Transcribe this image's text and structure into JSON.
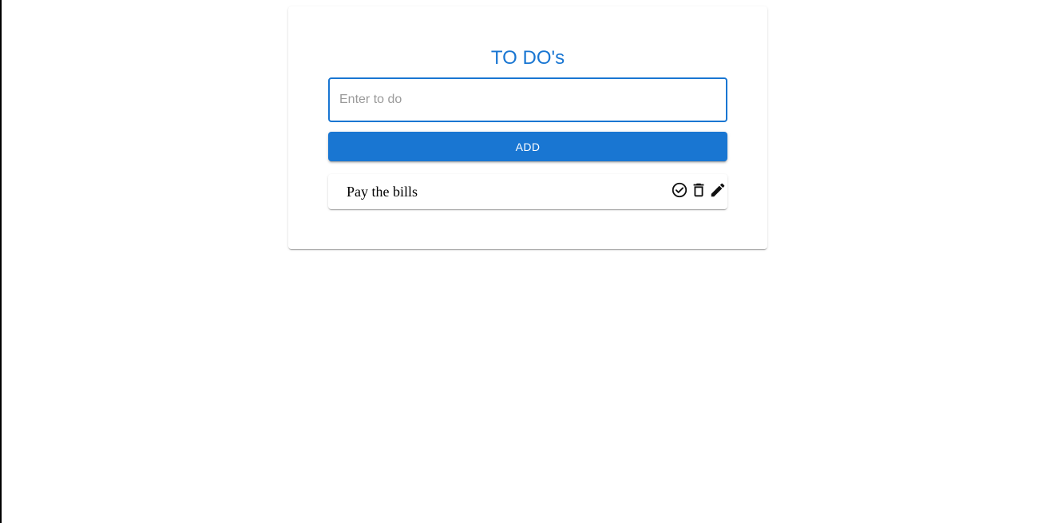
{
  "app": {
    "title": "TO DO's"
  },
  "input": {
    "placeholder": "Enter to do",
    "value": ""
  },
  "add_button": {
    "label": "ADD"
  },
  "todos": [
    {
      "text": "Pay the bills",
      "actions": [
        "check-circle-icon",
        "delete-icon",
        "edit-pencil-icon"
      ]
    }
  ],
  "colors": {
    "accent": "#1976d2",
    "text": "#000000",
    "placeholder": "#9a9a9a",
    "background": "#ffffff"
  }
}
